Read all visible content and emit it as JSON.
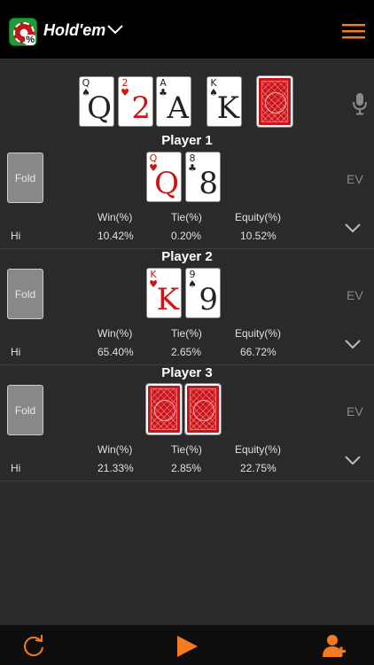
{
  "header": {
    "game_label": "Hold'em",
    "app_icon_badge": "%",
    "accent_color": "#f47b20"
  },
  "board": {
    "cards": [
      {
        "rank": "Q",
        "suit": "♠",
        "color": "black"
      },
      {
        "rank": "2",
        "suit": "♥",
        "color": "red"
      },
      {
        "rank": "A",
        "suit": "♣",
        "color": "black"
      },
      {
        "rank": "K",
        "suit": "♠",
        "color": "black"
      },
      {
        "rank": "",
        "suit": "",
        "color": "back"
      }
    ]
  },
  "columns": {
    "win": "Win(%)",
    "tie": "Tie(%)",
    "equity": "Equity(%)"
  },
  "players": [
    {
      "name": "Player 1",
      "fold_label": "Fold",
      "ev_label": "EV",
      "hand_label": "Hi",
      "cards": [
        {
          "rank": "Q",
          "suit": "♥",
          "color": "red"
        },
        {
          "rank": "8",
          "suit": "♣",
          "color": "black"
        }
      ],
      "win": "10.42%",
      "tie": "0.20%",
      "equity": "10.52%"
    },
    {
      "name": "Player 2",
      "fold_label": "Fold",
      "ev_label": "EV",
      "hand_label": "Hi",
      "cards": [
        {
          "rank": "K",
          "suit": "♥",
          "color": "red"
        },
        {
          "rank": "9",
          "suit": "♠",
          "color": "black"
        }
      ],
      "win": "65.40%",
      "tie": "2.65%",
      "equity": "66.72%"
    },
    {
      "name": "Player 3",
      "fold_label": "Fold",
      "ev_label": "EV",
      "hand_label": "Hi",
      "cards": [
        {
          "rank": "",
          "suit": "",
          "color": "back"
        },
        {
          "rank": "",
          "suit": "",
          "color": "back"
        }
      ],
      "win": "21.33%",
      "tie": "2.85%",
      "equity": "22.75%"
    }
  ],
  "icons": {
    "app": "app-logo-icon",
    "game_dropdown": "chevron-down-icon",
    "menu": "hamburger-menu-icon",
    "mic": "microphone-icon",
    "expand": "chevron-down-icon",
    "refresh": "refresh-icon",
    "play": "play-icon",
    "add_player": "add-user-icon"
  }
}
